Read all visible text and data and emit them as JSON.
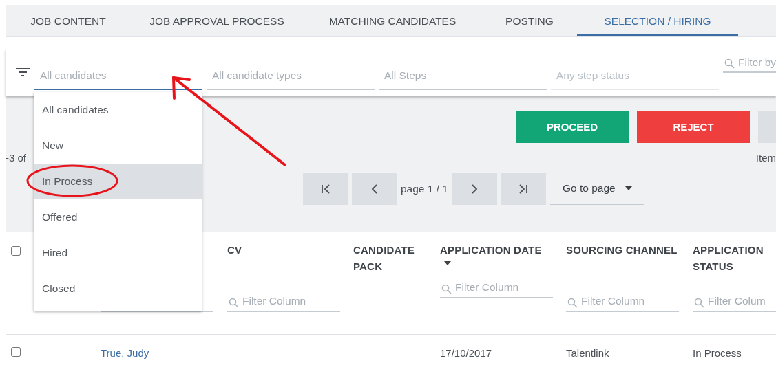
{
  "tabs": [
    {
      "label": "JOB CONTENT",
      "selected": false
    },
    {
      "label": "JOB APPROVAL PROCESS",
      "selected": false
    },
    {
      "label": "MATCHING CANDIDATES",
      "selected": false
    },
    {
      "label": "POSTING",
      "selected": false
    },
    {
      "label": "SELECTION / HIRING",
      "selected": true
    }
  ],
  "filters": {
    "fields": [
      {
        "placeholder": "All candidates",
        "focused": true,
        "disabled": false
      },
      {
        "placeholder": "All candidate types",
        "focused": false,
        "disabled": false
      },
      {
        "placeholder": "All Steps",
        "focused": false,
        "disabled": false
      },
      {
        "placeholder": "Any step status",
        "focused": false,
        "disabled": true
      }
    ],
    "search": {
      "placeholder": "Filter by"
    }
  },
  "actions": [
    {
      "kind": "proceed",
      "label": "PROCEED"
    },
    {
      "kind": "reject",
      "label": "REJECT"
    },
    {
      "kind": "partial"
    }
  ],
  "range_text": "-3 of",
  "items_text": "Item",
  "pagination": {
    "page_label": "page 1 / 1",
    "goto_label": "Go to page"
  },
  "table": {
    "select_all": {
      "checked": false
    },
    "columns": [
      {
        "has_filter": true,
        "sorted": false
      },
      {
        "label": "CV",
        "has_filter": true,
        "sorted": false,
        "filter_placeholder": "Filter Column"
      },
      {
        "label": "CANDIDATE PACK",
        "has_filter": false,
        "sorted": false
      },
      {
        "label": "APPLICATION DATE",
        "sorted": true,
        "has_filter": true,
        "filter_placeholder": "Filter Column"
      },
      {
        "label": "SOURCING CHANNEL",
        "has_filter": true,
        "sorted": false,
        "filter_placeholder": "Filter Column"
      },
      {
        "label": "APPLICATION STATUS",
        "has_filter": true,
        "sorted": false,
        "filter_placeholder": "Filter Colum"
      }
    ],
    "rows": [
      {
        "checked": false,
        "name": "True, Judy",
        "application_date": "17/10/2017",
        "sourcing_channel": "Talentlink",
        "application_status": "In Process"
      }
    ]
  },
  "dropdown": {
    "options": [
      {
        "label": "All candidates",
        "highlighted": false
      },
      {
        "label": "New",
        "highlighted": false
      },
      {
        "label": "In Process",
        "highlighted": true
      },
      {
        "label": "Offered",
        "highlighted": false
      },
      {
        "label": "Hired",
        "highlighted": false
      },
      {
        "label": "Closed",
        "highlighted": false
      }
    ]
  }
}
